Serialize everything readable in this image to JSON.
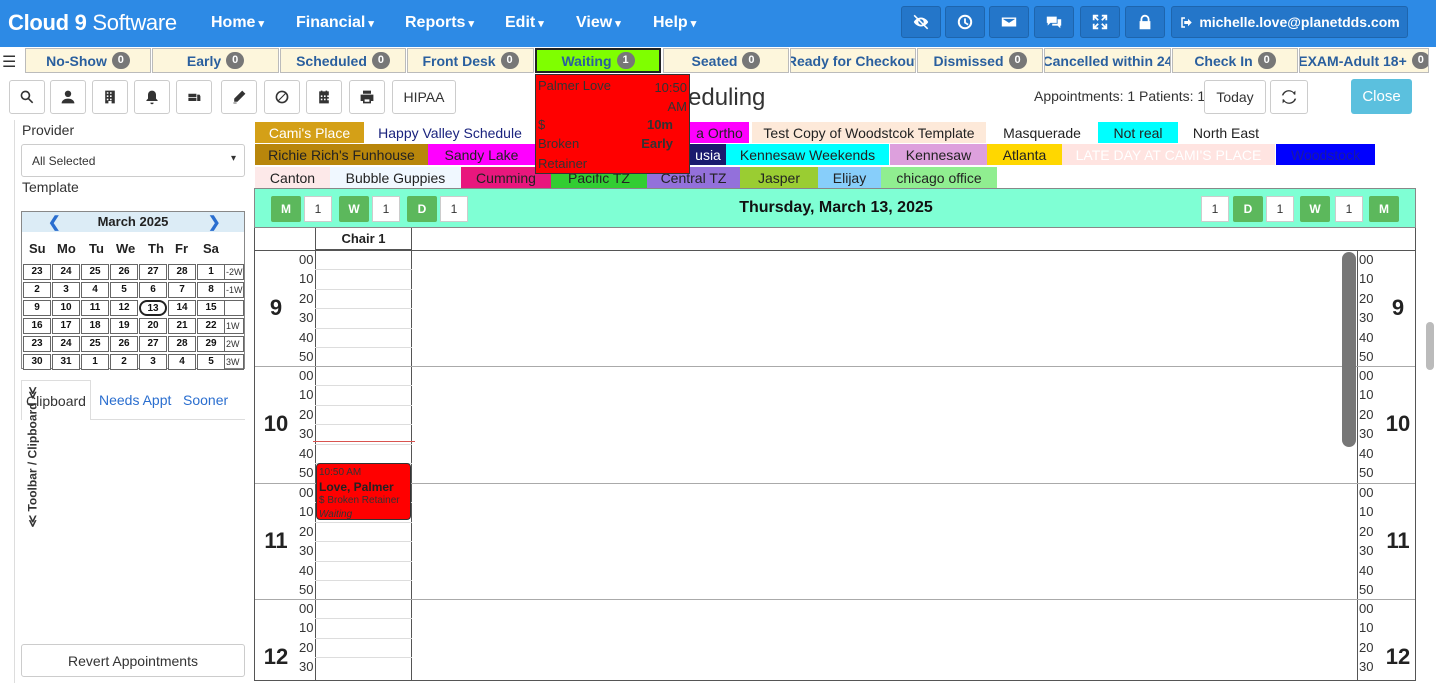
{
  "app": {
    "logo_main": "Cloud 9",
    "logo_sub": " Software",
    "menus": [
      "Home",
      "Financial",
      "Reports",
      "Edit",
      "View",
      "Help"
    ],
    "user": "michelle.love@planetdds.com",
    "nav_icons": [
      "eye-slash-icon",
      "clock-icon",
      "envelope-icon",
      "chat-icon",
      "expand-icon",
      "lock-icon"
    ]
  },
  "status_tabs": [
    {
      "label": "No-Show",
      "count": "0"
    },
    {
      "label": "Early",
      "count": "0"
    },
    {
      "label": "Scheduled",
      "count": "0"
    },
    {
      "label": "Front Desk",
      "count": "0"
    },
    {
      "label": "Waiting",
      "count": "1"
    },
    {
      "label": "Seated",
      "count": "0"
    },
    {
      "label": "Ready for Checkout",
      "count": ""
    },
    {
      "label": "Dismissed",
      "count": "0"
    },
    {
      "label": "Cancelled within 24",
      "count": ""
    },
    {
      "label": "Check In",
      "count": "0"
    },
    {
      "label": "EXAM-Adult 18+",
      "count": "0"
    }
  ],
  "waiting_popup": {
    "patient": "Palmer Love",
    "time": "10:50 AM",
    "amount": "$",
    "duration": "10m",
    "type": "Broken",
    "status": "Early",
    "subtype": "Retainer"
  },
  "toolbar": {
    "hipaa": "HIPAA",
    "title": "eduling",
    "appt_count": "Appointments: 1 Patients: 1",
    "today": "Today",
    "close": "Close"
  },
  "left": {
    "sidebar_toggle": "≪ Toolbar / Clipboard ≪",
    "provider_label": "Provider",
    "provider_value": "All Selected",
    "template_label": "Template",
    "calendar": {
      "month": "March 2025",
      "dows": [
        "Su",
        "Mo",
        "Tu",
        "We",
        "Th",
        "Fr",
        "Sa"
      ],
      "weeks": [
        {
          "days": [
            "23",
            "24",
            "25",
            "26",
            "27",
            "28",
            "1"
          ],
          "tag": "-2W"
        },
        {
          "days": [
            "2",
            "3",
            "4",
            "5",
            "6",
            "7",
            "8"
          ],
          "tag": "-1W"
        },
        {
          "days": [
            "9",
            "10",
            "11",
            "12",
            "13",
            "14",
            "15"
          ],
          "tag": ""
        },
        {
          "days": [
            "16",
            "17",
            "18",
            "19",
            "20",
            "21",
            "22"
          ],
          "tag": "1W"
        },
        {
          "days": [
            "23",
            "24",
            "25",
            "26",
            "27",
            "28",
            "29"
          ],
          "tag": "2W"
        },
        {
          "days": [
            "30",
            "31",
            "1",
            "2",
            "3",
            "4",
            "5"
          ],
          "tag": "3W"
        }
      ],
      "selected": "13"
    },
    "tabs": [
      "Clipboard",
      "Needs Appt",
      "Sooner"
    ],
    "revert": "Revert Appointments"
  },
  "locations": [
    {
      "label": "Cami's Place",
      "bg": "#d4a017",
      "fg": "#ffffff"
    },
    {
      "label": "Happy Valley Schedule",
      "bg": "#ffffff",
      "fg": "#1a237e"
    },
    {
      "label": "a Ortho",
      "bg": "#ff00ff",
      "fg": "#222222"
    },
    {
      "label": "Test Copy of Woodstcok Template",
      "bg": "#fde9d9",
      "fg": "#222222"
    },
    {
      "label": "Masquerade",
      "bg": "#ffffff",
      "fg": "#222222"
    },
    {
      "label": "Not real",
      "bg": "#00ffff",
      "fg": "#222222"
    },
    {
      "label": "North East",
      "bg": "#ffffff",
      "fg": "#222222"
    },
    {
      "label": "Richie Rich's Funhouse",
      "bg": "#b8860b",
      "fg": "#222222"
    },
    {
      "label": "Sandy Lake",
      "bg": "#ff00ff",
      "fg": "#222222"
    },
    {
      "label": "usia",
      "bg": "#1a1a6e",
      "fg": "#ffffff"
    },
    {
      "label": "Kennesaw Weekends",
      "bg": "#00ffff",
      "fg": "#222222"
    },
    {
      "label": "Kennesaw",
      "bg": "#dda0dd",
      "fg": "#222222"
    },
    {
      "label": "Atlanta",
      "bg": "#ffd700",
      "fg": "#222222"
    },
    {
      "label": "LATE DAY AT CAMI'S PLACE",
      "bg": "#ffe4e1",
      "fg": "#ffffff"
    },
    {
      "label": "Woodstock",
      "bg": "#0000ff",
      "fg": "#1a1aa0"
    },
    {
      "label": "Canton",
      "bg": "#fde9e9",
      "fg": "#222222"
    },
    {
      "label": "Bubble Guppies",
      "bg": "#f0f8ff",
      "fg": "#222222"
    },
    {
      "label": "Cumming",
      "bg": "#e8177d",
      "fg": "#222222"
    },
    {
      "label": "Pacific TZ",
      "bg": "#32cd32",
      "fg": "#222222"
    },
    {
      "label": "Central TZ",
      "bg": "#9370db",
      "fg": "#222222"
    },
    {
      "label": "Jasper",
      "bg": "#9acd32",
      "fg": "#222222"
    },
    {
      "label": "Elijay",
      "bg": "#87cefa",
      "fg": "#222222"
    },
    {
      "label": "chicago office",
      "bg": "#90ee90",
      "fg": "#222222"
    }
  ],
  "daynav": {
    "date": "Thursday, March 13, 2025",
    "left_buttons": [
      {
        "btn": "M",
        "val": "1"
      },
      {
        "btn": "W",
        "val": "1"
      },
      {
        "btn": "D",
        "val": "1"
      }
    ],
    "right_buttons": [
      {
        "val": "1",
        "btn": "D"
      },
      {
        "val": "1",
        "btn": "W"
      },
      {
        "val": "1",
        "btn": "M"
      }
    ]
  },
  "schedule": {
    "chair": "Chair 1",
    "hours": [
      "9",
      "10",
      "11",
      "12"
    ],
    "minutes": [
      "00",
      "10",
      "20",
      "30",
      "40",
      "50"
    ],
    "appointment": {
      "time": "10:50 AM",
      "name": "Love, Palmer",
      "desc": "$ Broken Retainer",
      "status": "Waiting",
      "color": "#ff0000"
    }
  }
}
